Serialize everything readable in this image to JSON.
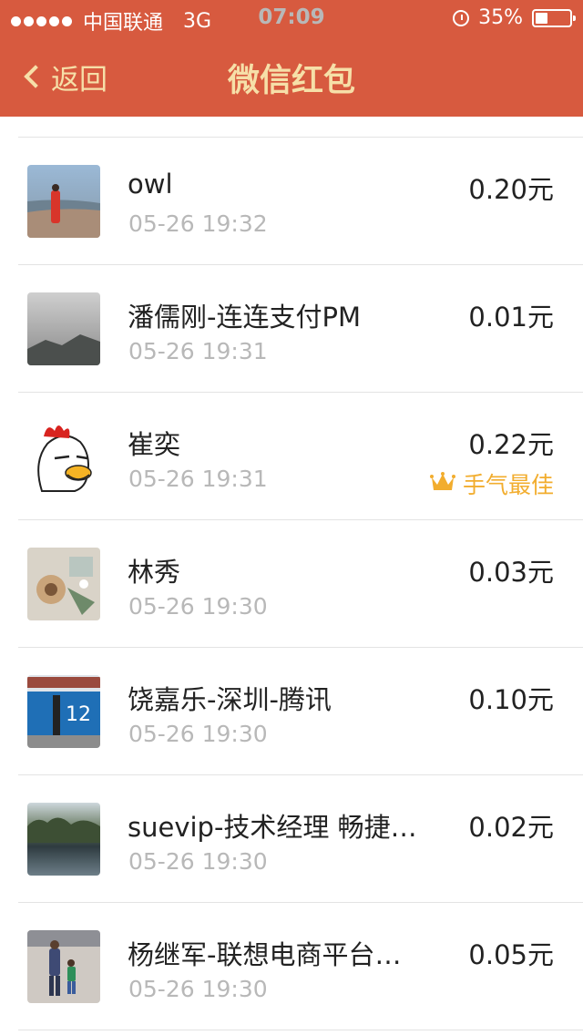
{
  "status_bar": {
    "carrier": "中国联通",
    "network": "3G",
    "time": "07:09",
    "battery_percent_text": "35%",
    "battery_level": 0.35
  },
  "nav": {
    "back_label": "返回",
    "title": "微信红包"
  },
  "colors": {
    "header_bg": "#d75a3f",
    "header_text": "#f6dfa8",
    "best_luck": "#f2ad2e"
  },
  "records": [
    {
      "name": "owl",
      "time": "05-26 19:32",
      "amount": "0.20元",
      "avatar": "beach-photo"
    },
    {
      "name": "潘儒刚-连连支付PM",
      "time": "05-26 19:31",
      "amount": "0.01元",
      "avatar": "foggy-mountain-photo"
    },
    {
      "name": "崔奕",
      "time": "05-26 19:31",
      "amount": "0.22元",
      "avatar": "cartoon-chicken",
      "best_luck_label": "手气最佳",
      "best_luck_icon": "crown-icon"
    },
    {
      "name": "林秀",
      "time": "05-26 19:30",
      "amount": "0.03元",
      "avatar": "still-life-photo"
    },
    {
      "name": "饶嘉乐-深圳-腾讯",
      "time": "05-26 19:30",
      "amount": "0.10元",
      "avatar": "street-sign-photo"
    },
    {
      "name": "suevip-技术经理 畅捷…",
      "time": "05-26 19:30",
      "amount": "0.02元",
      "avatar": "lake-photo"
    },
    {
      "name": "杨继军-联想电商平台…",
      "time": "05-26 19:30",
      "amount": "0.05元",
      "avatar": "parent-child-photo"
    }
  ]
}
